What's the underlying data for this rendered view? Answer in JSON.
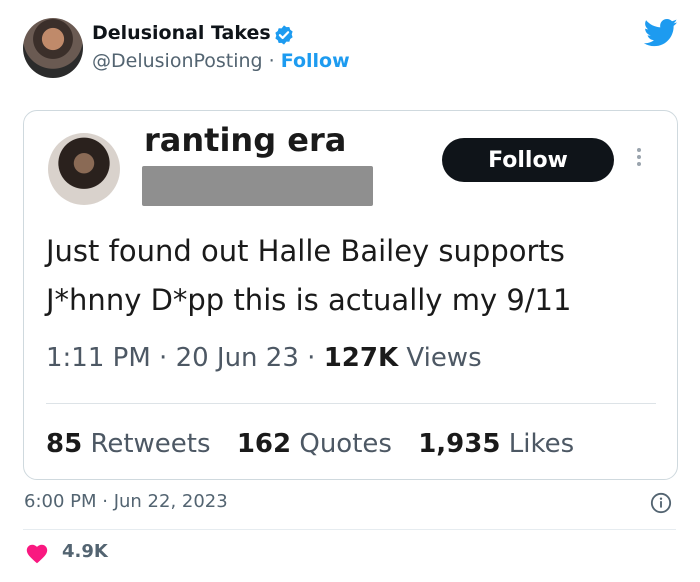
{
  "tweet": {
    "display_name": "Delusional Takes",
    "handle": "@DelusionPosting",
    "separator": "·",
    "follow_label": "Follow",
    "timestamp": "6:00 PM · Jun 22, 2023",
    "like_count": "4.9K",
    "icons": [
      "verified-icon",
      "twitter-bird-icon",
      "info-icon",
      "heart-icon"
    ],
    "colors": {
      "accent": "#1d9bf0",
      "heart": "#f91880",
      "text": "#0f1419",
      "muted": "#536471"
    }
  },
  "embedded": {
    "name": "ranting era",
    "follow_label": "Follow",
    "text_line1": "Just found out Halle Bailey supports",
    "text_line2": "J*hnny D*pp this is actually my 9/11",
    "time": "1:11 PM",
    "date": "20 Jun 23",
    "views_count": "127K",
    "views_label": "Views",
    "retweets_count": "85",
    "retweets_label": "Retweets",
    "quotes_count": "162",
    "quotes_label": "Quotes",
    "likes_count": "1,935",
    "likes_label": "Likes"
  }
}
